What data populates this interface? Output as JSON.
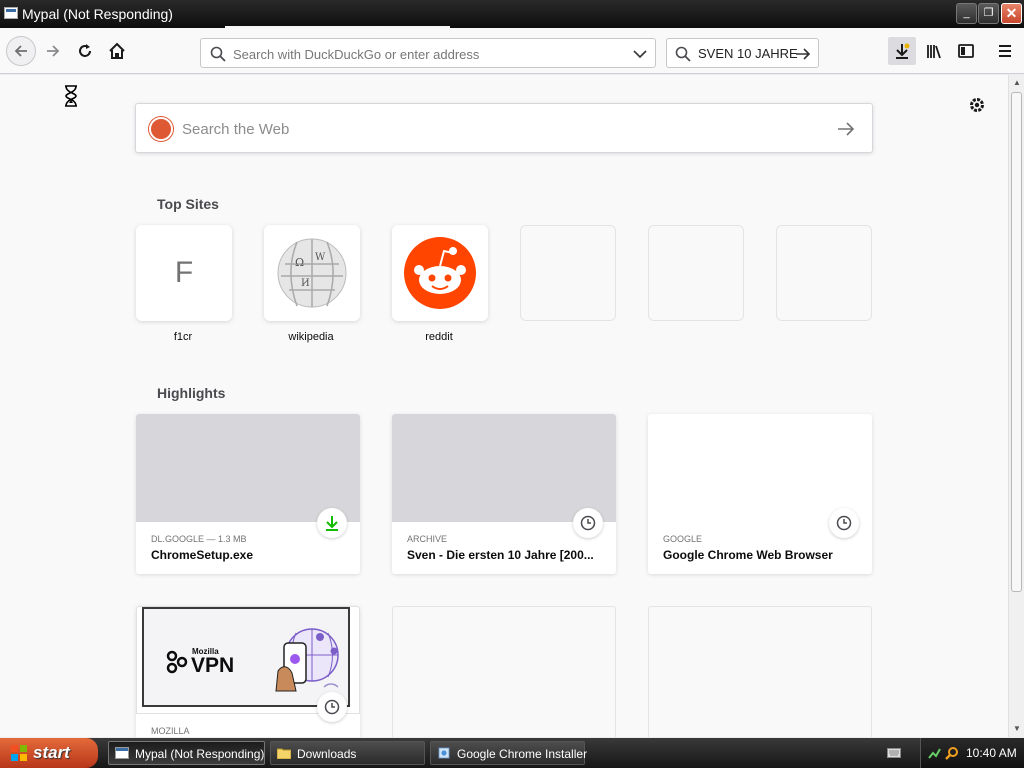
{
  "window": {
    "title": "Mypal (Not Responding)",
    "controls": {
      "minimize": "_",
      "maximize": "❐",
      "close": "✕"
    }
  },
  "toolbar": {
    "url_placeholder": "Search with DuckDuckGo or enter address",
    "search_engine_text": "SVEN 10 JAHRE"
  },
  "newtab": {
    "websearch_placeholder": "Search the Web",
    "top_sites_title": "Top Sites",
    "top_sites": [
      {
        "label": "f1cr",
        "letter": "F",
        "icon": "letter-tile"
      },
      {
        "label": "wikipedia",
        "icon": "wikipedia-globe-icon"
      },
      {
        "label": "reddit",
        "icon": "reddit-alien-icon"
      },
      {
        "label": ""
      },
      {
        "label": ""
      },
      {
        "label": ""
      }
    ],
    "highlights_title": "Highlights",
    "highlights": [
      {
        "meta": "DL.GOOGLE — 1.3 MB",
        "title": "ChromeSetup.exe",
        "badge": "download-icon"
      },
      {
        "meta": "ARCHIVE",
        "title": "Sven - Die ersten 10 Jahre [200...",
        "badge": "clock-icon"
      },
      {
        "meta": "GOOGLE",
        "title": "Google Chrome Web Browser",
        "badge": "clock-icon"
      },
      {
        "meta": "MOZILLA",
        "title": "",
        "badge": "clock-icon",
        "thumb_text": {
          "brand": "Mozilla",
          "product": "VPN"
        }
      }
    ]
  },
  "taskbar": {
    "start_label": "start",
    "items": [
      {
        "label": "Mypal (Not Responding)",
        "icon": "browser-icon",
        "active": true
      },
      {
        "label": "Downloads",
        "icon": "folder-icon",
        "active": false
      },
      {
        "label": "Google Chrome Installer",
        "icon": "installer-icon",
        "active": false
      }
    ],
    "clock": "10:40 AM"
  },
  "colors": {
    "accent_download": "#12bc00",
    "reddit": "#ff4500",
    "duckduckgo": "#de5833",
    "start_button": "#d24d2a"
  }
}
